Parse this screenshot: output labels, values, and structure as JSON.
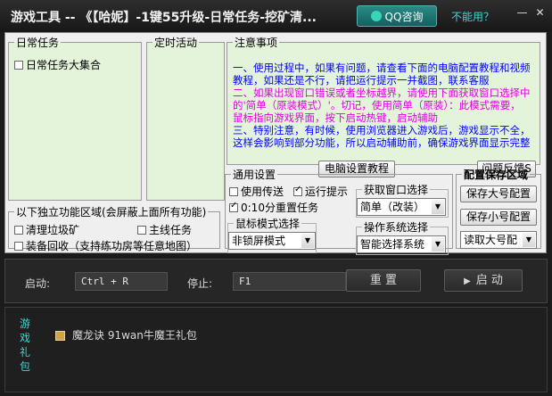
{
  "window": {
    "title": "游戏工具 -- 《【哈妮】-1键55升级-日常任务-挖矿清...",
    "qq_button": "QQ咨询",
    "cant_use_link": "不能用？",
    "minimize": "—",
    "close": "✕"
  },
  "daily_task": {
    "legend": "日常任务",
    "checkbox_label": "日常任务大集合",
    "checked": false
  },
  "timed_activity": {
    "legend": "定时活动"
  },
  "notice": {
    "legend": "注意事项",
    "p1": "一、使用过程中，如果有问题，请查看下面的电脑配置教程和视频教程，如果还是不行，请把运行提示一并截图，联系客服",
    "p2": "二、如果出现窗口错误或者坐标越界，请使用下面获取窗口选择中的'简单（原装模式）'。切记，使用简单（原装）：此模式需要，鼠标指向游戏界面，按下启动热键，启动辅助",
    "p3": "三、特别注意，有时候，使用浏览器进入游戏后，游戏显示不全，这样会影响到部分功能，所以启动辅助前，确保游戏界面显示完整",
    "pc_setup_button": "电脑设置教程",
    "feedback_button": "问题反馈S",
    "colors": {
      "p1": "#0000ff",
      "p2": "#e000e0",
      "p3": "#0000ff"
    }
  },
  "independent": {
    "legend": "以下独立功能区域(会屏蔽上面所有功能)",
    "clean_junk": "清理垃圾矿",
    "main_quest": "主线任务",
    "equip_recycle": "装备回收（支持练功房等任意地图）"
  },
  "general": {
    "legend": "通用设置",
    "use_transfer": "使用传送",
    "use_transfer_checked": false,
    "run_hint": "运行提示",
    "run_hint_checked": true,
    "reset_task": "0:10分重置任务",
    "reset_task_checked": true
  },
  "window_select": {
    "legend": "获取窗口选择",
    "value": "简单（改装）"
  },
  "mouse_mode": {
    "legend": "鼠标模式选择",
    "value": "非锁屏模式"
  },
  "os_select": {
    "legend": "操作系统选择",
    "value": "智能选择系统"
  },
  "config": {
    "legend": "配置保存区域",
    "save_main": "保存大号配置",
    "save_alt": "保存小号配置",
    "read_main": "读取大号配"
  },
  "control_bar": {
    "start_label": "启动:",
    "start_hotkey": "Ctrl + R",
    "stop_label": "停止:",
    "stop_hotkey": "F1",
    "reset_button": "重 置",
    "start_button": "启 动"
  },
  "gift": {
    "tab_label": "游戏礼包",
    "item": "魔龙诀 91wan牛魔王礼包"
  }
}
